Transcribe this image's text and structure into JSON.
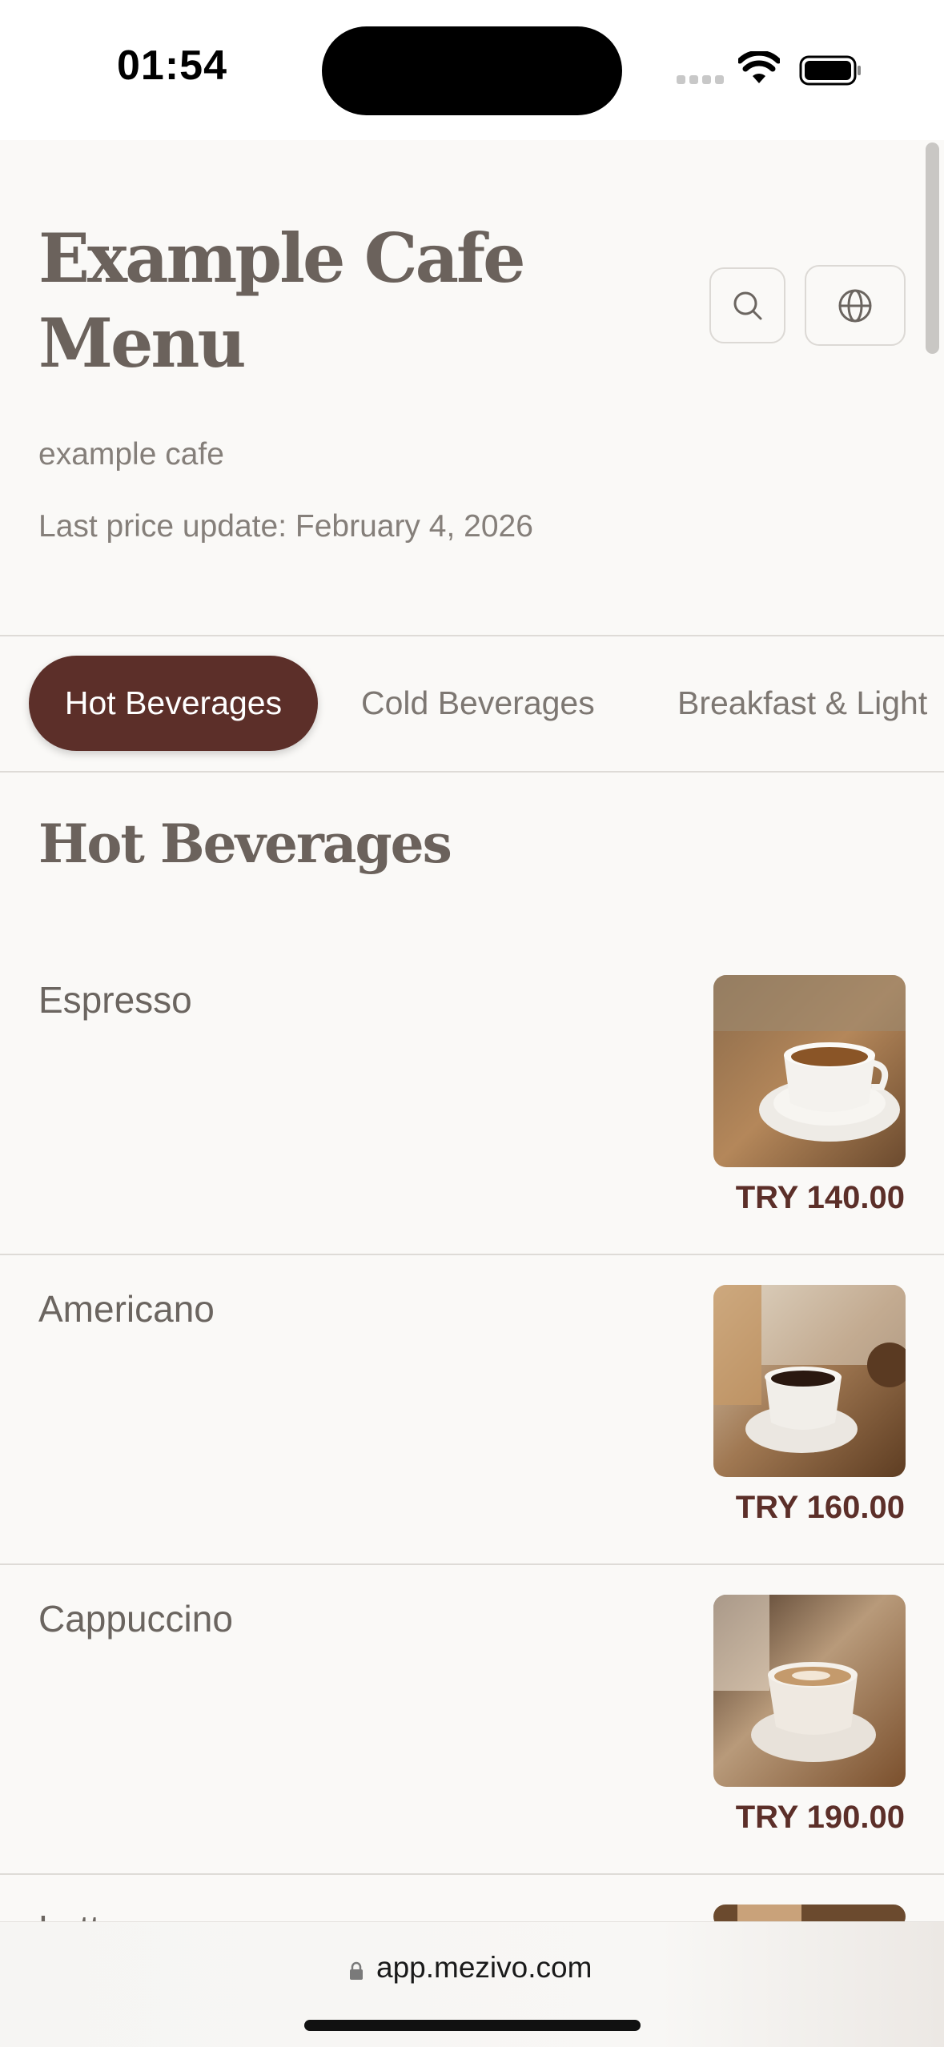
{
  "status_bar": {
    "time": "01:54"
  },
  "header": {
    "title": "Example Cafe Menu",
    "subtitle": "example cafe",
    "last_update": "Last price update: February 4, 2026"
  },
  "tabs": [
    {
      "label": "Hot Beverages",
      "active": true
    },
    {
      "label": "Cold Beverages",
      "active": false
    },
    {
      "label": "Breakfast & Light",
      "active": false
    }
  ],
  "section": {
    "title": "Hot Beverages"
  },
  "items": [
    {
      "name": "Espresso",
      "price": "TRY 140.00"
    },
    {
      "name": "Americano",
      "price": "TRY 160.00"
    },
    {
      "name": "Cappuccino",
      "price": "TRY 190.00"
    },
    {
      "name": "Latte",
      "price": ""
    }
  ],
  "browser": {
    "url": "app.mezivo.com"
  },
  "colors": {
    "accent": "#5c2f29",
    "background": "#faf9f7",
    "text": "#6b625c"
  },
  "icons": [
    "search-icon",
    "globe-icon",
    "lock-icon",
    "wifi-icon",
    "battery-icon"
  ]
}
